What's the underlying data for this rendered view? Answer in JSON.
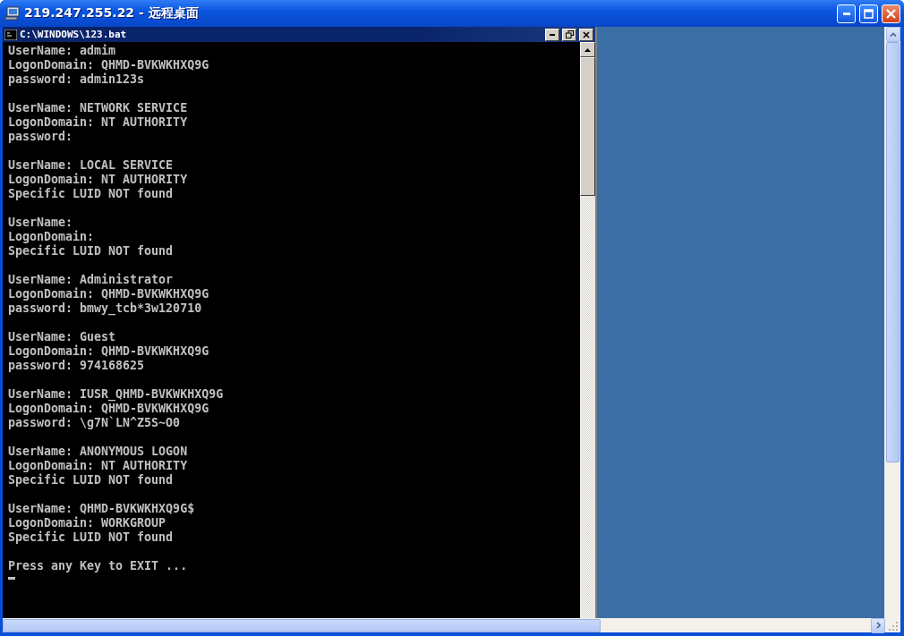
{
  "window": {
    "title": "219.247.255.22 - 远程桌面"
  },
  "console": {
    "title": "C:\\WINDOWS\\123.bat",
    "records": [
      {
        "lines": [
          "UserName: admim",
          "LogonDomain: QHMD-BVKWKHXQ9G",
          "password: admin123s"
        ]
      },
      {
        "lines": [
          "UserName: NETWORK SERVICE",
          "LogonDomain: NT AUTHORITY",
          "password:"
        ]
      },
      {
        "lines": [
          "UserName: LOCAL SERVICE",
          "LogonDomain: NT AUTHORITY",
          "Specific LUID NOT found"
        ]
      },
      {
        "lines": [
          "UserName:",
          "LogonDomain:",
          "Specific LUID NOT found"
        ]
      },
      {
        "lines": [
          "UserName: Administrator",
          "LogonDomain: QHMD-BVKWKHXQ9G",
          "password: bmwy_tcb*3w120710"
        ]
      },
      {
        "lines": [
          "UserName: Guest",
          "LogonDomain: QHMD-BVKWKHXQ9G",
          "password: 974168625"
        ]
      },
      {
        "lines": [
          "UserName: IUSR_QHMD-BVKWKHXQ9G",
          "LogonDomain: QHMD-BVKWKHXQ9G",
          "password: \\g7N`LN^Z5S~O0"
        ]
      },
      {
        "lines": [
          "UserName: ANONYMOUS LOGON",
          "LogonDomain: NT AUTHORITY",
          "Specific LUID NOT found"
        ]
      },
      {
        "lines": [
          "UserName: QHMD-BVKWKHXQ9G$",
          "LogonDomain: WORKGROUP",
          "Specific LUID NOT found"
        ]
      },
      {
        "lines": [
          "Press any Key to EXIT ..."
        ]
      }
    ]
  }
}
